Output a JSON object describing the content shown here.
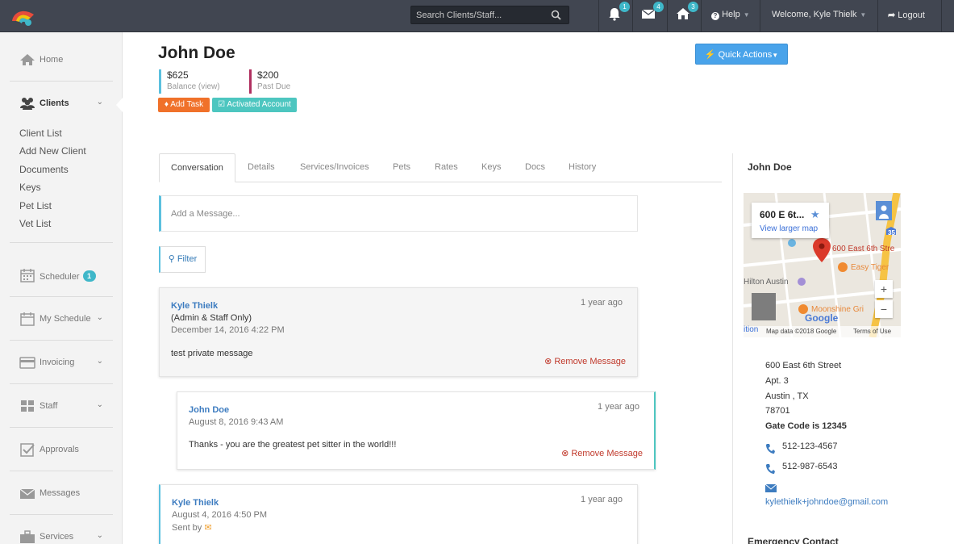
{
  "topbar": {
    "search_placeholder": "Search Clients/Staff...",
    "alerts_count": "1",
    "messages_count": "4",
    "home_count": "3",
    "help_label": "Help",
    "welcome_label": "Welcome, Kyle Thielk",
    "logout_label": "Logout"
  },
  "sidebar": {
    "home": "Home",
    "clients": "Clients",
    "sub_items": [
      "Client List",
      "Add New Client",
      "Documents",
      "Keys",
      "Pet List",
      "Vet List"
    ],
    "scheduler": "Scheduler",
    "scheduler_badge": "1",
    "my_schedule": "My Schedule",
    "invoicing": "Invoicing",
    "staff": "Staff",
    "approvals": "Approvals",
    "messages": "Messages",
    "services": "Services"
  },
  "client": {
    "name": "John Doe",
    "balance_value": "$625",
    "balance_label": "Balance (view)",
    "past_due_value": "$200",
    "past_due_label": "Past Due",
    "add_task": "Add Task",
    "activated": "Activated Account",
    "quick_actions": "Quick Actions"
  },
  "tabs": [
    "Conversation",
    "Details",
    "Services/Invoices",
    "Pets",
    "Rates",
    "Keys",
    "Docs",
    "History"
  ],
  "conversation": {
    "message_placeholder": "Add a Message...",
    "filter_label": "Filter",
    "messages": [
      {
        "author": "Kyle Thielk",
        "note": "(Admin & Staff Only)",
        "date": "December 14, 2016 4:22 PM",
        "ago": "1 year ago",
        "body": "test private message",
        "remove": "Remove Message"
      },
      {
        "author": "John Doe",
        "date": "August 8, 2016 9:43 AM",
        "ago": "1 year ago",
        "body": "Thanks - you are the greatest pet sitter in the world!!!",
        "remove": "Remove Message"
      },
      {
        "author": "Kyle Thielk",
        "date": "August 4, 2016 4:50 PM",
        "ago": "1 year ago",
        "sent_by": "Sent by"
      }
    ]
  },
  "right_panel": {
    "name": "John Doe",
    "map": {
      "card_title": "600 E 6t...",
      "card_link": "View larger map",
      "place_1": "600 East 6th Stre",
      "place_2": "Easy Tiger",
      "place_3": "Hilton Austin",
      "place_4": "Moonshine Gri",
      "place_5": "ition",
      "google": "Google",
      "map_data": "Map data ©2018 Google",
      "terms": "Terms of Use",
      "shield": "35",
      "zoom_in": "+",
      "zoom_out": "−"
    },
    "address_lines": [
      "600 East 6th Street",
      "Apt. 3",
      "Austin , TX",
      "78701"
    ],
    "gate_code": "Gate Code is 12345",
    "phones": [
      "512-123-4567",
      "512-987-6543"
    ],
    "email": "kylethielk+johndoe@gmail.com",
    "emergency_title": "Emergency Contact"
  },
  "colors": {
    "topbar": "#414651",
    "accent_teal": "#3fb7c9",
    "link_blue": "#3d7cc0",
    "task_orange": "#f0712a",
    "activated_teal": "#4dc6c0",
    "quick_blue": "#49a3ea",
    "remove_red": "#c0392b"
  }
}
